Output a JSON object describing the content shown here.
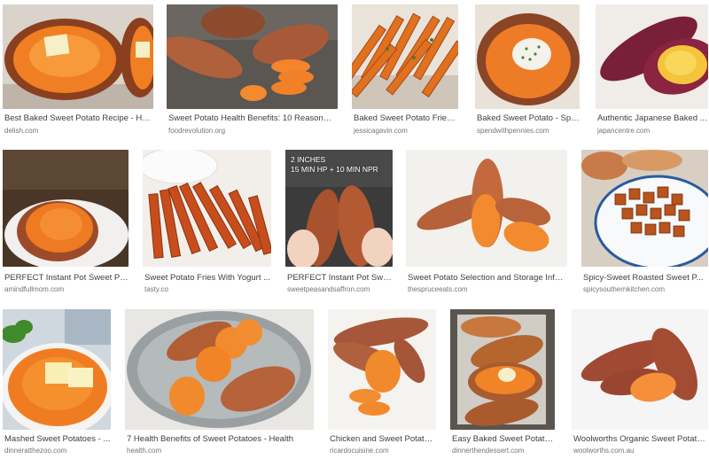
{
  "results": [
    {
      "title": "Best Baked Sweet Potato Recipe - Ho...",
      "source": "delish.com"
    },
    {
      "title": "Sweet Potato Health Benefits: 10 Reasons T...",
      "source": "foodrevolution.org"
    },
    {
      "title": "Baked Sweet Potato Fries ...",
      "source": "jessicagavin.com"
    },
    {
      "title": "Baked Sweet Potato - Spe...",
      "source": "spendwithpennies.com"
    },
    {
      "title": "Authentic Japanese Baked ...",
      "source": "japancentre.com"
    },
    {
      "title": "PERFECT Instant Pot Sweet Pot...",
      "source": "amindfullmom.com"
    },
    {
      "title": "Sweet Potato Fries With Yogurt ...",
      "source": "tasty.co"
    },
    {
      "title": "PERFECT Instant Pot Swe...",
      "source": "sweetpeasandsaffron.com",
      "overlay": [
        "2 INCHES",
        "15 MIN HP + 10 MIN NPR"
      ]
    },
    {
      "title": "Sweet Potato Selection and Storage Infor...",
      "source": "thespruceeats.com"
    },
    {
      "title": "Spicy-Sweet Roasted Sweet P...",
      "source": "spicysouthernkitchen.com"
    },
    {
      "title": "Mashed Sweet Potatoes - ...",
      "source": "dinneratthezoo.com"
    },
    {
      "title": "7 Health Benefits of Sweet Potatoes - Health",
      "source": "health.com"
    },
    {
      "title": "Chicken and Sweet Potato ...",
      "source": "ricardocuisine.com"
    },
    {
      "title": "Easy Baked Sweet Potato...",
      "source": "dinnerthendessert.com"
    },
    {
      "title": "Woolworths Organic Sweet Potato ...",
      "source": "woolworths.com.au"
    }
  ],
  "colors": {
    "potato_skin": "#a9532e",
    "potato_flesh": "#f28a2e",
    "title_text": "#3c4043",
    "source_text": "#70757a"
  }
}
